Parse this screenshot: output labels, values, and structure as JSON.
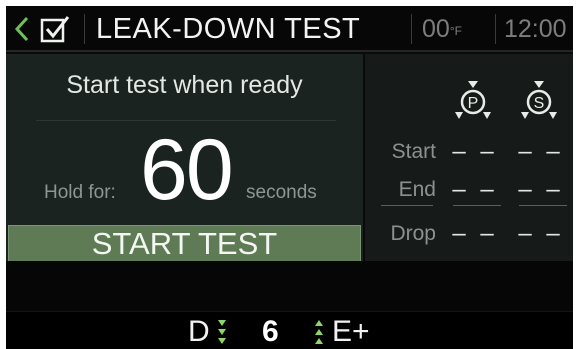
{
  "header": {
    "title": "LEAK-DOWN TEST",
    "temperature": "00",
    "temperature_unit": "°F",
    "clock": "12:00"
  },
  "left_panel": {
    "prompt": "Start test when ready",
    "hold_label": "Hold for:",
    "hold_value": "60",
    "hold_unit": "seconds",
    "start_button_label": "START TEST"
  },
  "right_panel": {
    "columns": [
      {
        "icon": "primary-pressure-gauge-icon",
        "letter": "P"
      },
      {
        "icon": "secondary-pressure-gauge-icon",
        "letter": "S"
      }
    ],
    "rows": [
      {
        "label": "Start",
        "values": [
          "– –",
          "– –"
        ]
      },
      {
        "label": "End",
        "values": [
          "– –",
          "– –"
        ]
      },
      {
        "label": "Drop",
        "values": [
          "– –",
          "– –"
        ]
      }
    ]
  },
  "gear_bar": {
    "drive_mode": "D",
    "gear": "6",
    "mode": "E+"
  },
  "colors": {
    "screen_background": "#0a0a0a",
    "panel_background": "#1b2321",
    "button_green": "#5e7b55",
    "arrow_green": "#8fd66a"
  }
}
